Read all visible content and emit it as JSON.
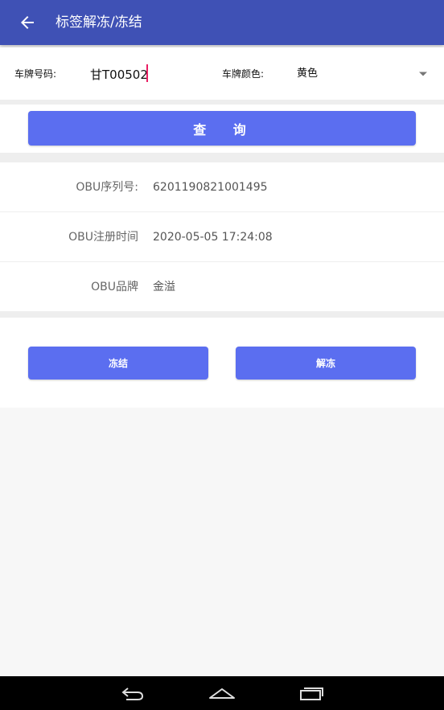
{
  "appbar": {
    "title": "标签解冻/冻结",
    "back_icon": "arrow-left-icon"
  },
  "form": {
    "plate_label": "车牌号码:",
    "plate_value": "甘T00502",
    "color_label": "车牌颜色:",
    "color_value": "黄色"
  },
  "query_button": "查 询",
  "info": [
    {
      "label": "OBU序列号:",
      "value": "6201190821001495"
    },
    {
      "label": "OBU注册时间",
      "value": "2020-05-05 17:24:08"
    },
    {
      "label": "OBU品牌",
      "value": "金溢"
    }
  ],
  "actions": {
    "freeze_label": "冻结",
    "unfreeze_label": "解冻"
  },
  "navbar": {
    "icons": [
      "back-nav-icon",
      "home-nav-icon",
      "recents-nav-icon"
    ]
  },
  "colors": {
    "primary": "#3f51b5",
    "button": "#5b6ef0",
    "caret": "#e91e63"
  }
}
